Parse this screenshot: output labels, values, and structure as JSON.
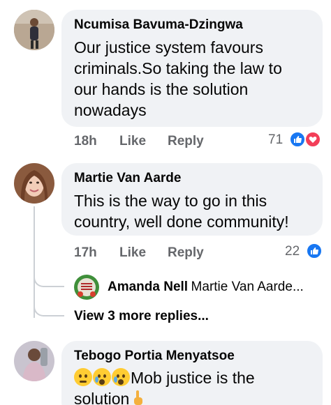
{
  "comments": [
    {
      "author": "Ncumisa Bavuma-Dzingwa",
      "text_lines": [
        "Our justice system favours",
        "criminals.So taking the law to",
        "our hands is the solution",
        "nowadays"
      ],
      "time": "18h",
      "like_label": "Like",
      "reply_label": "Reply",
      "reaction_count": "71",
      "reactions": [
        "like-icon",
        "love-icon"
      ]
    },
    {
      "author": "Martie Van Aarde",
      "text_lines": [
        "This is the way to go in this",
        "country, well done community!"
      ],
      "time": "17h",
      "like_label": "Like",
      "reply_label": "Reply",
      "reaction_count": "22",
      "reactions": [
        "like-icon"
      ],
      "reply_preview": {
        "author": "Amanda Nell",
        "text": "Martie Van Aarde..."
      },
      "view_more": "View 3 more replies..."
    },
    {
      "author": "Tebogo Portia Menyatsoe",
      "text_line1": "Mob justice is the",
      "text_line2": "solution",
      "emojis": [
        "thinking-face-icon",
        "crying-face-icon",
        "crying-face-icon"
      ],
      "end_emoji": "pointing-up-hand-icon"
    }
  ],
  "colors": {
    "bubble": "#f0f2f5",
    "meta": "#65676b",
    "like": "#1877f2",
    "love": "#f33e58"
  }
}
